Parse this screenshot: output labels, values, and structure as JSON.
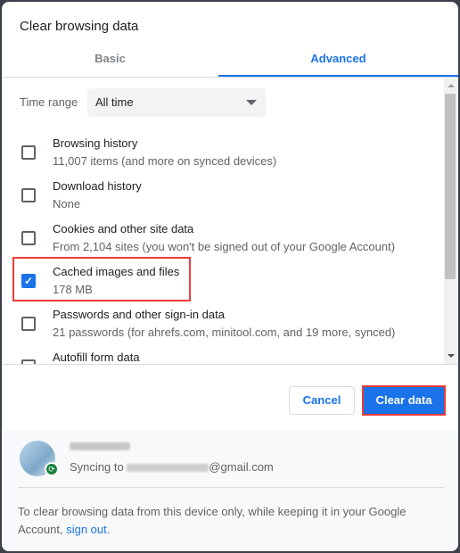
{
  "dialog": {
    "title": "Clear browsing data"
  },
  "tabs": [
    {
      "label": "Basic",
      "active": false
    },
    {
      "label": "Advanced",
      "active": true
    }
  ],
  "time_range": {
    "label": "Time range",
    "value": "All time"
  },
  "items": [
    {
      "title": "Browsing history",
      "subtitle": "11,007 items (and more on synced devices)",
      "checked": false
    },
    {
      "title": "Download history",
      "subtitle": "None",
      "checked": false
    },
    {
      "title": "Cookies and other site data",
      "subtitle": "From 2,104 sites (you won't be signed out of your Google Account)",
      "checked": false
    },
    {
      "title": "Cached images and files",
      "subtitle": "178 MB",
      "checked": true
    },
    {
      "title": "Passwords and other sign-in data",
      "subtitle": "21 passwords (for ahrefs.com, minitool.com, and 19 more, synced)",
      "checked": false
    },
    {
      "title": "Autofill form data",
      "subtitle": "",
      "checked": false
    }
  ],
  "buttons": {
    "cancel": "Cancel",
    "clear": "Clear data"
  },
  "account": {
    "syncing_prefix": "Syncing to ",
    "email_suffix": "@gmail.com"
  },
  "note": {
    "text": "To clear browsing data from this device only, while keeping it in your Google Account, ",
    "link": "sign out",
    "end": "."
  },
  "colors": {
    "accent": "#1a73e8",
    "highlight": "#ef3b3b",
    "sync_badge": "#188038"
  }
}
